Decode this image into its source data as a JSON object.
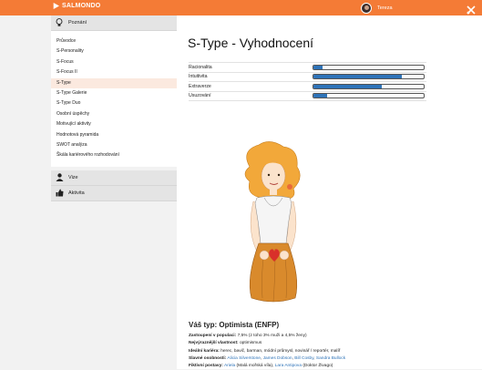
{
  "topbar": {
    "brand": "SALMONDO",
    "user_name": "Tereza",
    "accent": "#f47b36"
  },
  "sidebar": {
    "sections": [
      {
        "label": "Poznání",
        "items": [
          {
            "label": "Průvodce"
          },
          {
            "label": "S-Personality"
          },
          {
            "label": "S-Focus"
          },
          {
            "label": "S-Focus II"
          },
          {
            "label": "S-Type",
            "active": true
          },
          {
            "label": "S-Type Galerie"
          },
          {
            "label": "S-Type Duo"
          },
          {
            "label": "Osobní úspěchy"
          },
          {
            "label": "Motivující aktivity"
          },
          {
            "label": "Hodnotová pyramida"
          },
          {
            "label": "SWOT analýza"
          },
          {
            "label": "Škála kariérového rozhodování"
          }
        ]
      },
      {
        "label": "Vize"
      },
      {
        "label": "Aktivita"
      }
    ]
  },
  "main": {
    "title": "S-Type - Vyhodnocení",
    "traits": [
      {
        "label": "Racionalita",
        "value": 0.08
      },
      {
        "label": "Intuitivita",
        "value": 0.8
      },
      {
        "label": "Extraverze",
        "value": 0.62
      },
      {
        "label": "Usuzování",
        "value": 0.12
      }
    ],
    "bar_color": "#2e73b8",
    "type_heading": "Váš typ: Optimista (ENFP)",
    "info": {
      "representation_label": "Zastoupení v populaci:",
      "representation_value": " 7,5% (z toho 3% muži a 4,5% ženy)",
      "weakness_label": "Nejvýraznější vlastnost:",
      "weakness_value": " optimismus",
      "career_label": "Ideální kariéra:",
      "career_value": " herec, bavič, barman, módní průmysl, novinář / reportér, malíř",
      "famous_label": "Slavné osobnosti:",
      "famous": [
        "Alicia Silverstone",
        "James Dobson",
        "Bill Cosby",
        "Sandra Bullock"
      ],
      "fictional_label": "Fiktivní postavy:",
      "fictional_1": "Ariela",
      "fictional_1_note": " (Malá mořská víla), ",
      "fictional_2": "Lara Antipova",
      "fictional_2_note": " (Doktor Živago)"
    }
  }
}
